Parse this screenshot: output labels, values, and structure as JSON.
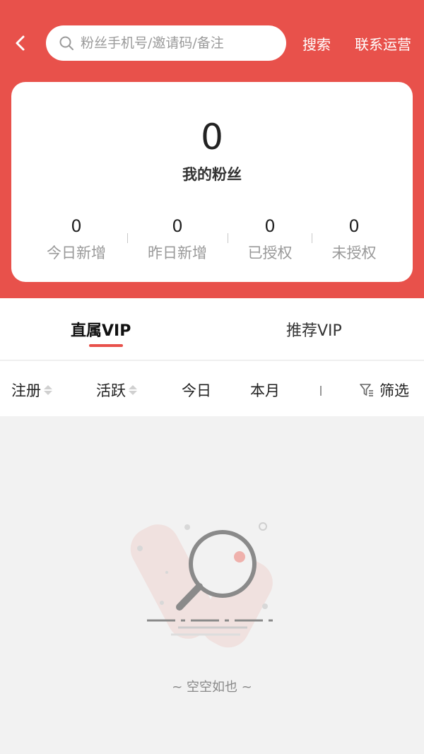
{
  "header": {
    "back_icon": "chevron-left-icon",
    "search_placeholder": "粉丝手机号/邀请码/备注",
    "search_icon": "search-icon",
    "search_label": "搜索",
    "contact_label": "联系运营",
    "bg_color": "#e8514b"
  },
  "summary": {
    "total": "0",
    "total_label": "我的粉丝",
    "stats": [
      {
        "value": "0",
        "label": "今日新增"
      },
      {
        "value": "0",
        "label": "昨日新增"
      },
      {
        "value": "0",
        "label": "已授权"
      },
      {
        "value": "0",
        "label": "未授权"
      }
    ]
  },
  "tabs": [
    {
      "label": "直属VIP",
      "active": true
    },
    {
      "label": "推荐VIP",
      "active": false
    }
  ],
  "filters": {
    "register": "注册",
    "active": "活跃",
    "today": "今日",
    "month": "本月",
    "filter_label": "筛选",
    "filter_icon": "funnel-icon"
  },
  "empty": {
    "illustration": "empty-search-illustration",
    "text": "~ 空空如也 ~"
  }
}
